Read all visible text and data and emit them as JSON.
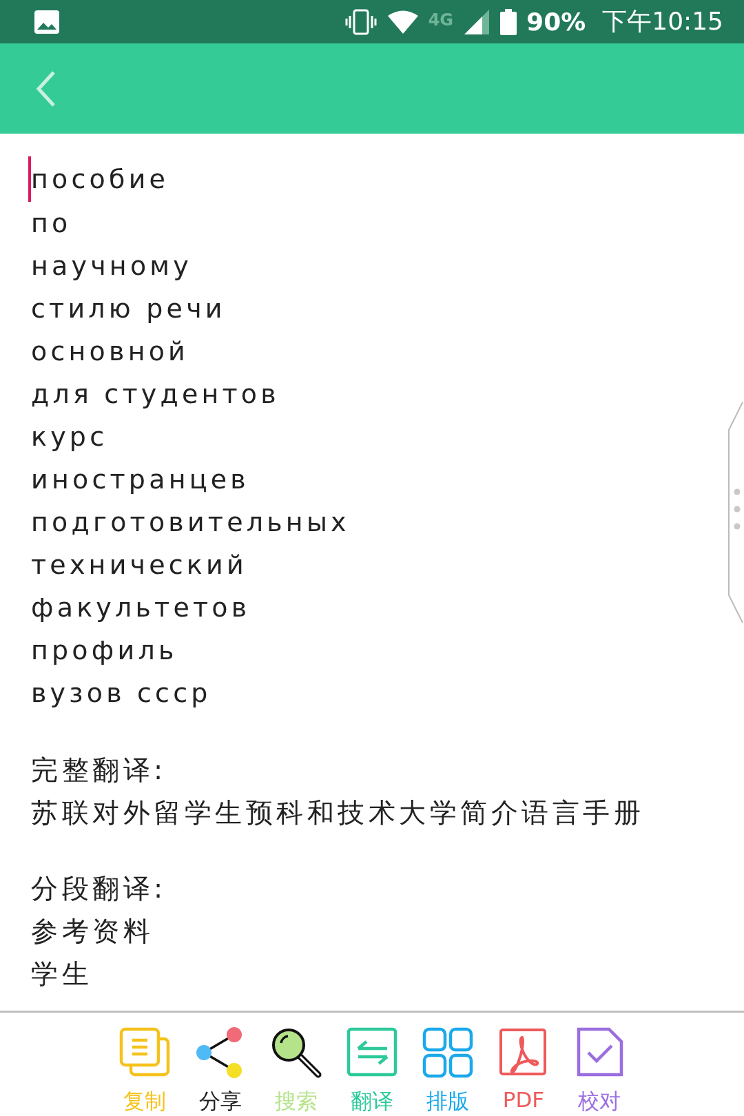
{
  "status_bar": {
    "network": "4G",
    "battery": "90%",
    "time": "下午10:15"
  },
  "document": {
    "lines": [
      "пособие",
      "по",
      "научному",
      "стилю речи",
      "основной",
      "для студентов",
      "курс",
      "иностранцев",
      "подготовительных",
      "технический",
      "факультетов",
      "профиль",
      "вузов ссср"
    ]
  },
  "full_translation": {
    "label": "完整翻译:",
    "text": "苏联对外留学生预科和技术大学简介语言手册"
  },
  "segment_translation": {
    "label": "分段翻译:",
    "lines": [
      "参考资料",
      "学生"
    ]
  },
  "toolbar": [
    {
      "kind": "copy",
      "label": "复制",
      "color": "#f5c21b"
    },
    {
      "kind": "share",
      "label": "分享",
      "color": "#222222"
    },
    {
      "kind": "search",
      "label": "搜索",
      "color": "#b5e38a"
    },
    {
      "kind": "translate",
      "label": "翻译",
      "color": "#2ec99b"
    },
    {
      "kind": "layout",
      "label": "排版",
      "color": "#1aa9ea"
    },
    {
      "kind": "pdf",
      "label": "PDF",
      "color": "#ee5a5a"
    },
    {
      "kind": "proofread",
      "label": "校对",
      "color": "#9b6ee0"
    }
  ]
}
